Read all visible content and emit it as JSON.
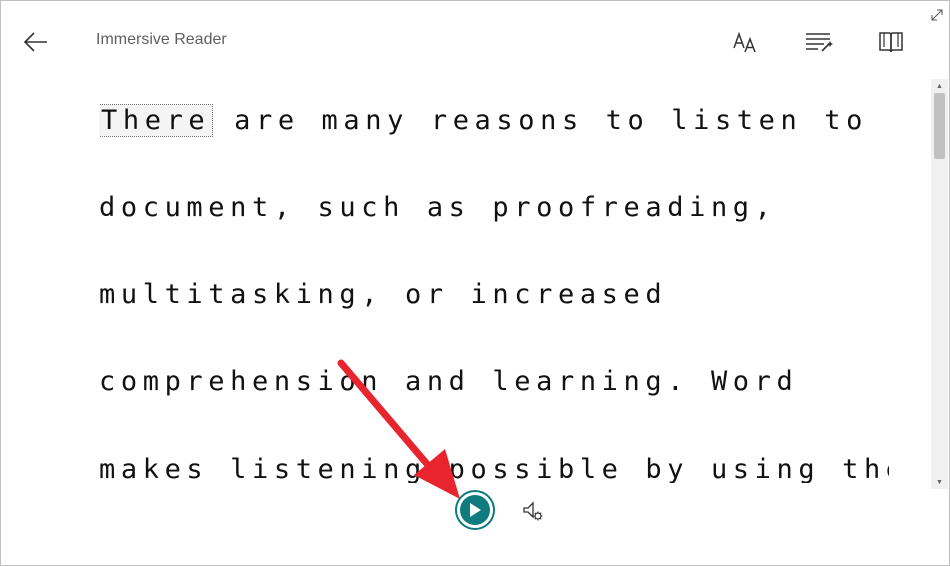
{
  "header": {
    "title": "Immersive Reader",
    "icons": [
      "back-arrow-icon",
      "text-preferences-icon",
      "grammar-options-icon",
      "reading-preferences-icon",
      "expand-icon"
    ]
  },
  "content": {
    "lines": [
      {
        "highlighted": "There",
        "rest": " are many reasons to listen to a"
      },
      {
        "text": "document, such as proofreading,"
      },
      {
        "text": "multitasking, or increased"
      },
      {
        "text": "comprehension and learning. Word"
      },
      {
        "text": "makes listening possible by using the"
      }
    ]
  },
  "controls": {
    "icons": [
      "play-icon",
      "voice-settings-icon"
    ]
  },
  "colors": {
    "accent": "#0f7b7e",
    "annotation_arrow": "#e8242f",
    "text": "#111111"
  }
}
